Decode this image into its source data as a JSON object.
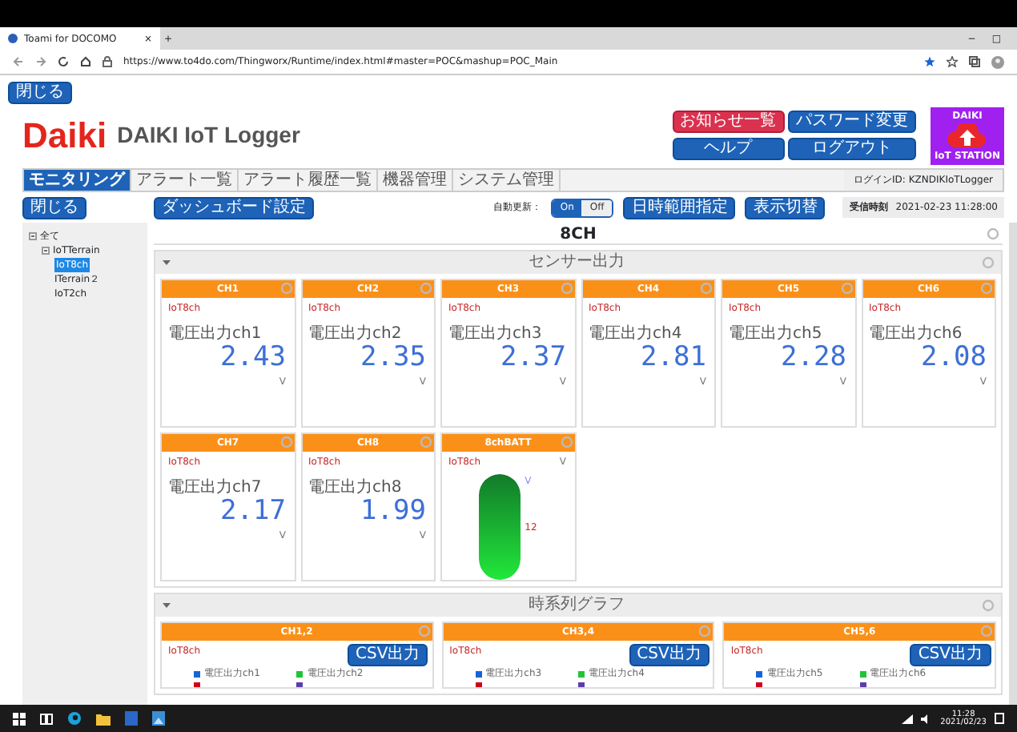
{
  "browser": {
    "tab_title": "Toami for DOCOMO",
    "tab_close": "×",
    "new_tab": "+",
    "url": "https://www.to4do.com/Thingworx/Runtime/index.html#master=POC&mashup=POC_Main",
    "window_controls": [
      "−",
      "□"
    ]
  },
  "top_button": "閉じる",
  "logo": {
    "brand": "Daiki",
    "title": "DAIKI IoT Logger"
  },
  "header_buttons": [
    {
      "label": "お知らせ一覧",
      "kind": "danger"
    },
    {
      "label": "パスワード変更",
      "kind": "primary"
    },
    {
      "label": "ヘルプ",
      "kind": "primary"
    },
    {
      "label": "ログアウト",
      "kind": "primary"
    }
  ],
  "badge": {
    "title": "DAIKI",
    "subtitle": "IoT STATION"
  },
  "tabs": [
    {
      "label": "モニタリング",
      "selected": true
    },
    {
      "label": "アラート一覧",
      "selected": false
    },
    {
      "label": "アラート履歴一覧",
      "selected": false
    },
    {
      "label": "機器管理",
      "selected": false
    },
    {
      "label": "システム管理",
      "selected": false
    }
  ],
  "login": "ログインID: KZNDIKIoTLogger",
  "sidebar": {
    "close": "閉じる",
    "tree": [
      {
        "label": "全て",
        "selected": false,
        "children": [
          {
            "label": "IoTTerrain",
            "selected": false,
            "children": [
              {
                "label": "IoT8ch",
                "selected": true
              },
              {
                "label": "ITerrain２",
                "selected": false
              },
              {
                "label": "IoT2ch",
                "selected": false
              }
            ]
          }
        ]
      }
    ]
  },
  "toolbar": {
    "dashboard_button": "ダッシュボード設定",
    "auto_update_label": "自動更新：",
    "toggle": [
      {
        "label": "On",
        "selected": true
      },
      {
        "label": "Off",
        "selected": false
      }
    ],
    "buttons": [
      "日時範囲指定",
      "表示切替"
    ],
    "received_label": "受信時刻",
    "received_time": "2021-02-23 11:28:00"
  },
  "page_title": "8CH",
  "sections": [
    {
      "title": "センサー出力",
      "expanded": true,
      "cards": [
        {
          "kind": "meter",
          "title": "CH1",
          "device": "IoT8ch",
          "label": "電圧出力ch1",
          "value": "2.43",
          "unit": "V"
        },
        {
          "kind": "meter",
          "title": "CH2",
          "device": "IoT8ch",
          "label": "電圧出力ch2",
          "value": "2.35",
          "unit": "V"
        },
        {
          "kind": "meter",
          "title": "CH3",
          "device": "IoT8ch",
          "label": "電圧出力ch3",
          "value": "2.37",
          "unit": "V"
        },
        {
          "kind": "meter",
          "title": "CH4",
          "device": "IoT8ch",
          "label": "電圧出力ch4",
          "value": "2.81",
          "unit": "V"
        },
        {
          "kind": "meter",
          "title": "CH5",
          "device": "IoT8ch",
          "label": "電圧出力ch5",
          "value": "2.28",
          "unit": "V"
        },
        {
          "kind": "meter",
          "title": "CH6",
          "device": "IoT8ch",
          "label": "電圧出力ch6",
          "value": "2.08",
          "unit": "V"
        },
        {
          "kind": "meter",
          "title": "CH7",
          "device": "IoT8ch",
          "label": "電圧出力ch7",
          "value": "2.17",
          "unit": "V"
        },
        {
          "kind": "meter",
          "title": "CH8",
          "device": "IoT8ch",
          "label": "電圧出力ch8",
          "value": "1.99",
          "unit": "V"
        },
        {
          "kind": "battery",
          "title": "8chBATT",
          "device": "IoT8ch",
          "unit": "V",
          "scale_unit": "V",
          "reading": "12",
          "level": 1
        }
      ]
    },
    {
      "title": "時系列グラフ",
      "expanded": true,
      "cards": [
        {
          "kind": "chart",
          "title": "CH1,2",
          "device": "IoT8ch",
          "button": "CSV出力",
          "legend": [
            {
              "label": "電圧出力ch1",
              "color": "#1565d8"
            },
            {
              "label": "電圧出力ch2",
              "color": "#22c33a"
            },
            {
              "color": "#d0021b"
            },
            {
              "color": "#5b3fa8"
            }
          ]
        },
        {
          "kind": "chart",
          "title": "CH3,4",
          "device": "IoT8ch",
          "button": "CSV出力",
          "legend": [
            {
              "label": "電圧出力ch3",
              "color": "#1565d8"
            },
            {
              "label": "電圧出力ch4",
              "color": "#22c33a"
            },
            {
              "color": "#d0021b"
            },
            {
              "color": "#5b3fa8"
            }
          ]
        },
        {
          "kind": "chart",
          "title": "CH5,6",
          "device": "IoT8ch",
          "button": "CSV出力",
          "legend": [
            {
              "label": "電圧出力ch5",
              "color": "#1565d8"
            },
            {
              "label": "電圧出力ch6",
              "color": "#22c33a"
            },
            {
              "color": "#d0021b"
            },
            {
              "color": "#5b3fa8"
            }
          ]
        }
      ]
    }
  ],
  "taskbar": {
    "time": "11:28",
    "date": "2021/02/23"
  }
}
